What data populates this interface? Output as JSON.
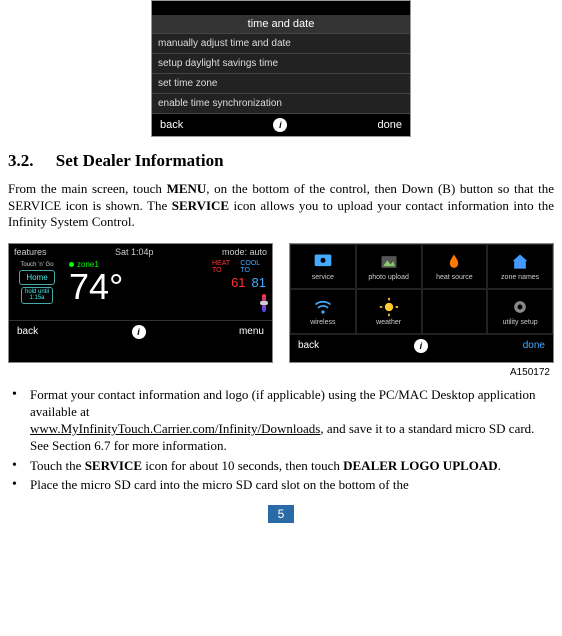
{
  "screenshot1": {
    "title": "time and date",
    "rows": [
      "manually adjust time and date",
      "setup daylight savings time",
      "set time zone",
      "enable time synchronization"
    ],
    "back": "back",
    "done": "done"
  },
  "section": {
    "number": "3.2.",
    "title": "Set Dealer Information"
  },
  "paragraph": {
    "t1": "From the main screen, touch ",
    "menu": "MENU",
    "t2": ", on the bottom of the control, then Down (B) button so that the SERVICE icon is shown. The ",
    "service": "SERVICE",
    "t3": " icon allows you to upload your contact information into the Infinity System Control."
  },
  "shotL": {
    "features": "features",
    "clock": "Sat 1:04p",
    "mode": "mode: auto",
    "touch": "Touch ’n’ Go",
    "home": "Home",
    "hold1": "hold until",
    "hold2": "1:15a",
    "zone": "zone1",
    "temp": "74°",
    "heatto": "HEAT TO",
    "coolto": "COOL TO",
    "heatval": "61",
    "coolval": "81",
    "back": "back",
    "menu": "menu"
  },
  "shotR": {
    "cells": [
      "service",
      "photo upload",
      "heat source",
      "zone names",
      "wireless",
      "weather",
      "",
      "utility setup"
    ],
    "back": "back",
    "done": "done"
  },
  "figure_id": "A150172",
  "bullets": {
    "b1_t1": "Format your contact information and logo (if applicable) using the PC/MAC Desktop application available at ",
    "b1_link": "www.MyInfinityTouch.Carrier.com/Infinity/Downloads",
    "b1_t2": ", and save it to a standard micro SD card. See Section 6.7 for more information.",
    "b2_t1": "Touch the ",
    "b2_service": "SERVICE",
    "b2_t2": " icon for about 10 seconds, then touch ",
    "b2_dealer": "DEALER LOGO UPLOAD",
    "b2_t3": ".",
    "b3": "Place the micro SD card into the micro SD card slot on the bottom of the"
  },
  "page_number": "5"
}
